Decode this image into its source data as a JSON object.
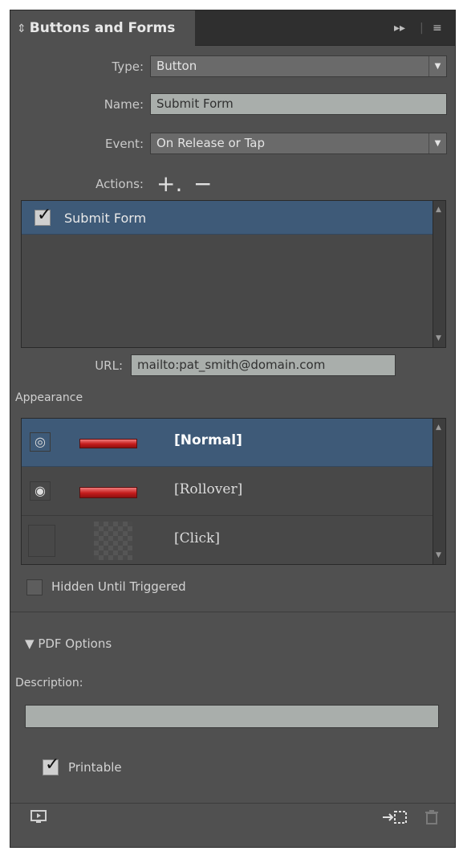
{
  "panel": {
    "title": "Buttons and Forms",
    "title_icon": "⇕",
    "menu_expand": "▸▸",
    "menu_icon": "≡"
  },
  "form": {
    "type_label": "Type:",
    "type_value": "Button",
    "name_label": "Name:",
    "name_value": "Submit Form",
    "event_label": "Event:",
    "event_value": "On Release or Tap",
    "actions_label": "Actions:",
    "add_action": "+.",
    "remove_action": "−"
  },
  "actions_list": [
    {
      "label": "Submit Form",
      "checked": true
    }
  ],
  "url": {
    "label": "URL:",
    "value": "mailto:pat_smith@domain.com"
  },
  "appearance": {
    "label": "Appearance",
    "states": [
      {
        "label": "[Normal]",
        "selected": true
      },
      {
        "label": "[Rollover]",
        "selected": false
      },
      {
        "label": "[Click]",
        "selected": false
      }
    ]
  },
  "hidden_until_triggered": {
    "label": "Hidden Until Triggered",
    "checked": false
  },
  "pdf_options": {
    "label": "PDF Options",
    "description_label": "Description:",
    "description_value": "",
    "printable_label": "Printable",
    "printable_checked": true
  },
  "footer": {
    "preview_icon": "preview-icon",
    "convert_icon": "convert-icon",
    "delete_icon": "trash-icon"
  }
}
